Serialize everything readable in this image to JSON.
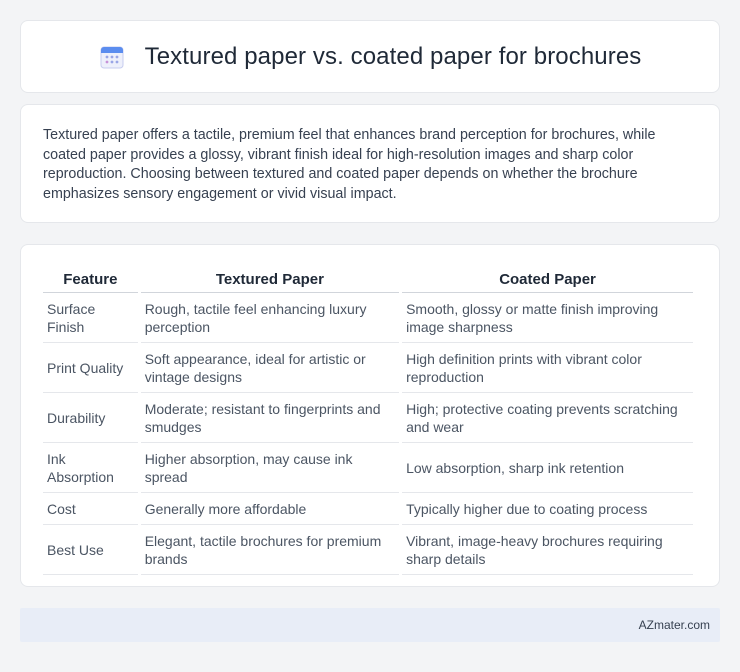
{
  "header": {
    "icon": "calendar-icon",
    "title": "Textured paper vs. coated paper for brochures"
  },
  "summary": "Textured paper offers a tactile, premium feel that enhances brand perception for brochures, while coated paper provides a glossy, vibrant finish ideal for high-resolution images and sharp color reproduction. Choosing between textured and coated paper depends on whether the brochure emphasizes sensory engagement or vivid visual impact.",
  "table": {
    "headers": [
      "Feature",
      "Textured Paper",
      "Coated Paper"
    ],
    "rows": [
      [
        "Surface Finish",
        "Rough, tactile feel enhancing luxury perception",
        "Smooth, glossy or matte finish improving image sharpness"
      ],
      [
        "Print Quality",
        "Soft appearance, ideal for artistic or vintage designs",
        "High definition prints with vibrant color reproduction"
      ],
      [
        "Durability",
        "Moderate; resistant to fingerprints and smudges",
        "High; protective coating prevents scratching and wear"
      ],
      [
        "Ink Absorption",
        "Higher absorption, may cause ink spread",
        "Low absorption, sharp ink retention"
      ],
      [
        "Cost",
        "Generally more affordable",
        "Typically higher due to coating process"
      ],
      [
        "Best Use",
        "Elegant, tactile brochures for premium brands",
        "Vibrant, image-heavy brochures requiring sharp details"
      ]
    ]
  },
  "footer": {
    "site": "AZmater.com"
  }
}
